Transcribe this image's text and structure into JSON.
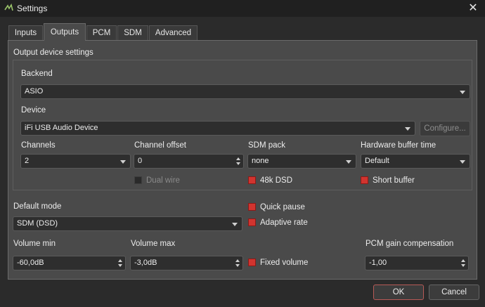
{
  "window": {
    "title": "Settings",
    "close_glyph": "✕"
  },
  "tabs": [
    {
      "label": "Inputs"
    },
    {
      "label": "Outputs"
    },
    {
      "label": "PCM"
    },
    {
      "label": "SDM"
    },
    {
      "label": "Advanced"
    }
  ],
  "active_tab": "Outputs",
  "output_device": {
    "group_title": "Output device settings",
    "backend_label": "Backend",
    "backend_value": "ASIO",
    "device_label": "Device",
    "device_value": "iFi USB Audio Device",
    "configure_label": "Configure...",
    "channels_label": "Channels",
    "channels_value": "2",
    "channel_offset_label": "Channel offset",
    "channel_offset_value": "0",
    "sdm_pack_label": "SDM pack",
    "sdm_pack_value": "none",
    "hw_buffer_label": "Hardware buffer time",
    "hw_buffer_value": "Default",
    "dual_wire_label": "Dual wire",
    "dual_wire_checked": false,
    "dsd48k_label": "48k DSD",
    "dsd48k_checked": true,
    "short_buffer_label": "Short buffer",
    "short_buffer_checked": true
  },
  "mode": {
    "default_mode_label": "Default mode",
    "default_mode_value": "SDM (DSD)",
    "quick_pause_label": "Quick pause",
    "quick_pause_checked": true,
    "adaptive_rate_label": "Adaptive rate",
    "adaptive_rate_checked": true
  },
  "volume": {
    "min_label": "Volume min",
    "min_value": "-60,0dB",
    "max_label": "Volume max",
    "max_value": "-3,0dB",
    "fixed_label": "Fixed volume",
    "fixed_checked": true,
    "pcm_gain_label": "PCM gain compensation",
    "pcm_gain_value": "-1,00"
  },
  "buttons": {
    "ok": "OK",
    "cancel": "Cancel"
  },
  "colors": {
    "accent": "#d1342f",
    "panel": "#4a4a4a",
    "background": "#2b2b2b"
  }
}
